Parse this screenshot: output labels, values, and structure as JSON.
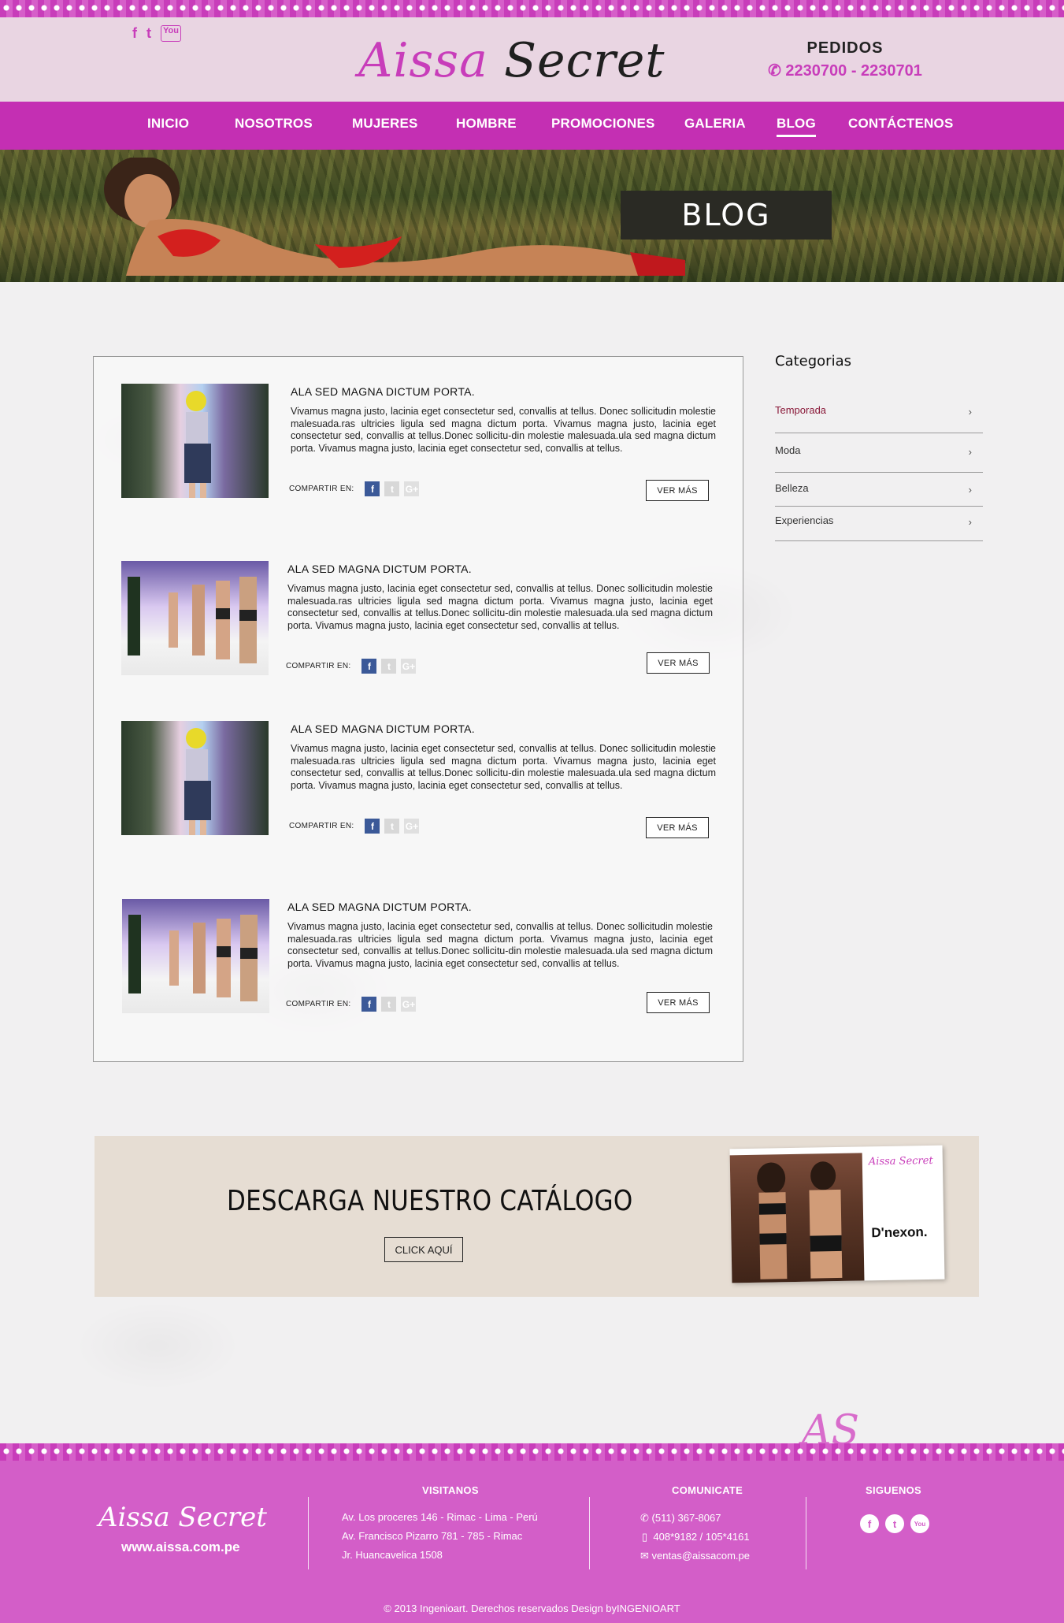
{
  "header": {
    "social": [
      "f",
      "t",
      "You"
    ],
    "logo": {
      "part1": "Aissa",
      "part2": "Secret"
    },
    "pedidos_title": "PEDIDOS",
    "pedidos_phone": "2230700 -  2230701",
    "phone_icon": "phone-icon"
  },
  "nav": {
    "items": [
      "INICIO",
      "NOSOTROS",
      "MUJERES",
      "HOMBRE",
      "PROMOCIONES",
      "GALERIA",
      "BLOG",
      "CONTÁCTENOS"
    ],
    "active": "BLOG"
  },
  "hero": {
    "title": "BLOG"
  },
  "posts": [
    {
      "title": "ALA SED MAGNA DICTUM PORTA.",
      "text": "Vivamus magna justo, lacinia eget consectetur sed, convallis at tellus. Donec sollicitudin molestie malesuada.ras ultricies ligula sed magna dictum porta. Vivamus magna justo, lacinia eget consectetur sed, convallis at tellus.Donec sollicitu-din molestie malesuada.ula sed magna dictum porta. Vivamus magna justo, lacinia eget consectetur sed, convallis at tellus.",
      "share_label": "COMPARTIR EN:",
      "more_label": "VER MÁS"
    },
    {
      "title": "ALA SED MAGNA DICTUM PORTA.",
      "text": "Vivamus magna justo, lacinia eget consectetur sed, convallis at tellus. Donec sollicitudin molestie malesuada.ras ultricies ligula sed magna dictum porta. Vivamus magna justo, lacinia eget consectetur sed, convallis at tellus.Donec sollicitu-din molestie malesuada.ula sed magna dictum porta. Vivamus magna justo, lacinia eget consectetur sed, convallis at tellus.",
      "share_label": "COMPARTIR EN:",
      "more_label": "VER MÁS"
    },
    {
      "title": "ALA SED MAGNA DICTUM PORTA.",
      "text": "Vivamus magna justo, lacinia eget consectetur sed, convallis at tellus. Donec sollicitudin molestie malesuada.ras ultricies ligula sed magna dictum porta. Vivamus magna justo, lacinia eget consectetur sed, convallis at tellus.Donec sollicitu-din molestie malesuada.ula sed magna dictum porta. Vivamus magna justo, lacinia eget consectetur sed, convallis at tellus.",
      "share_label": "COMPARTIR EN:",
      "more_label": "VER MÁS"
    },
    {
      "title": "ALA SED MAGNA DICTUM PORTA.",
      "text": "Vivamus magna justo, lacinia eget consectetur sed, convallis at tellus. Donec sollicitudin molestie malesuada.ras ultricies ligula sed magna dictum porta. Vivamus magna justo, lacinia eget consectetur sed, convallis at tellus.Donec sollicitu-din molestie malesuada.ula sed magna dictum porta. Vivamus magna justo, lacinia eget consectetur sed, convallis at tellus.",
      "share_label": "COMPARTIR EN:",
      "more_label": "VER MÁS"
    }
  ],
  "categories": {
    "title": "Categorias",
    "items": [
      "Temporada",
      "Moda",
      "Belleza",
      "Experiencias"
    ]
  },
  "catalog": {
    "heading": "DESCARGA NUESTRO CATÁLOGO",
    "button": "CLICK AQUÍ",
    "cover_brand": "D'nexon."
  },
  "footer": {
    "logo": "Aissa Secret",
    "url": "www.aissa.com.pe",
    "visitanos_title": "VISITANOS",
    "visitanos": [
      "Av. Los proceres 146 - Rimac - Lima - Perú",
      "Av. Francisco Pizarro 781 - 785 - Rimac",
      "Jr. Huancavelica 1508"
    ],
    "comunicate_title": "COMUNICATE",
    "comunicate": [
      "(511) 367-8067",
      "408*9182 / 105*4161",
      "ventas@aissacom.pe"
    ],
    "siguenos_title": "SIGUENOS",
    "copyright": "© 2013 Ingenioart. Derechos reservados Design byINGENIOART"
  },
  "colors": {
    "brand": "#c42fb3",
    "footer": "#d35ec8",
    "header_bg": "#e9d5e2"
  }
}
